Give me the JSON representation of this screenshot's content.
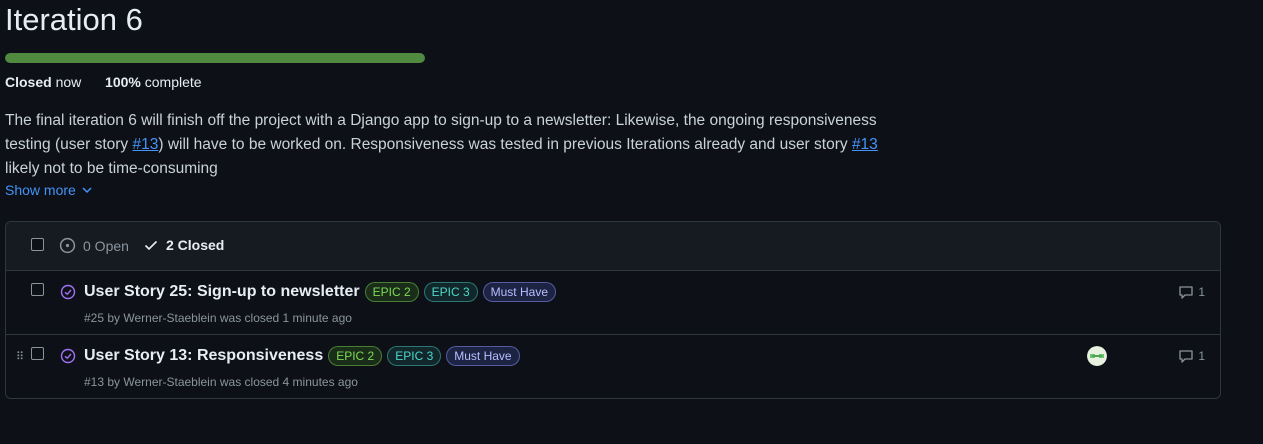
{
  "milestone": {
    "title": "Iteration 6",
    "progress_fraction": 1.0,
    "status": "Closed",
    "status_time": "now",
    "percent": "100%",
    "percent_suffix": "complete"
  },
  "description": {
    "line1": "The final iteration 6 will finish off the project with a Django app to sign-up to a newsletter: Likewise, the ongoing responsiveness",
    "line2_a": "testing (user story ",
    "line2_link1": "#13",
    "line2_b": ") will have to be worked on. Responsiveness was tested in previous Iterations already and user story ",
    "line2_link2": "#13",
    "line3": "likely not to be time-consuming",
    "show_more": "Show more"
  },
  "filters": {
    "open_label": "0 Open",
    "closed_label": "2 Closed"
  },
  "issues": [
    {
      "title": "User Story 25: Sign-up to newsletter",
      "labels": [
        "EPIC 2",
        "EPIC 3",
        "Must Have"
      ],
      "meta": "#25 by Werner-Staeblein was closed 1 minute ago",
      "comments": "1"
    },
    {
      "title": "User Story 13: Responsiveness",
      "labels": [
        "EPIC 2",
        "EPIC 3",
        "Must Have"
      ],
      "meta": "#13 by Werner-Staeblein was closed 4 minutes ago",
      "comments": "1"
    }
  ],
  "colors": {
    "progress": "#4f8a3f",
    "link": "#4493f8",
    "closed_icon": "#a371f7"
  },
  "icons": {
    "chevron": "chevron-down-icon",
    "open": "issue-open-icon",
    "check": "check-icon",
    "closed_issue": "issue-closed-icon",
    "comment": "comment-icon",
    "drag": "grabber-icon",
    "avatar": "avatar"
  }
}
